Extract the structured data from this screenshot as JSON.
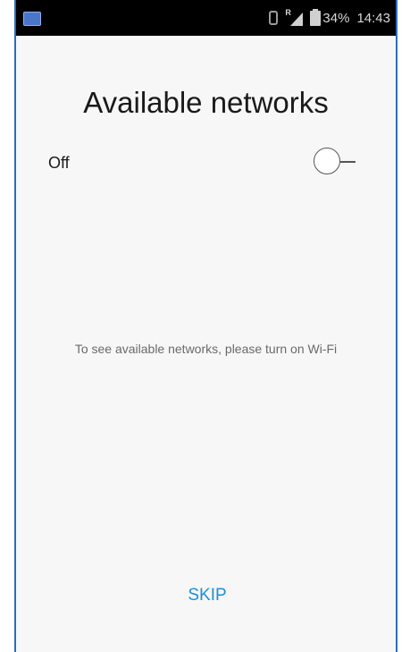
{
  "status_bar": {
    "notification_icon": "app-notification-icon",
    "bluetooth_icon": "bluetooth-icon",
    "signal_icon": "signal-roaming-icon",
    "roaming_label": "R",
    "battery_icon": "battery-icon",
    "battery_level": "34%",
    "time": "14:43"
  },
  "screen": {
    "title": "Available networks",
    "wifi": {
      "state_label": "Off",
      "enabled": false
    },
    "message": "To see available networks, please turn on Wi-Fi",
    "skip_label": "SKIP"
  },
  "colors": {
    "frame_border": "#2e6db8",
    "status_bar": "#000000",
    "background": "#f7f7f7",
    "accent": "#1f8fd6"
  }
}
